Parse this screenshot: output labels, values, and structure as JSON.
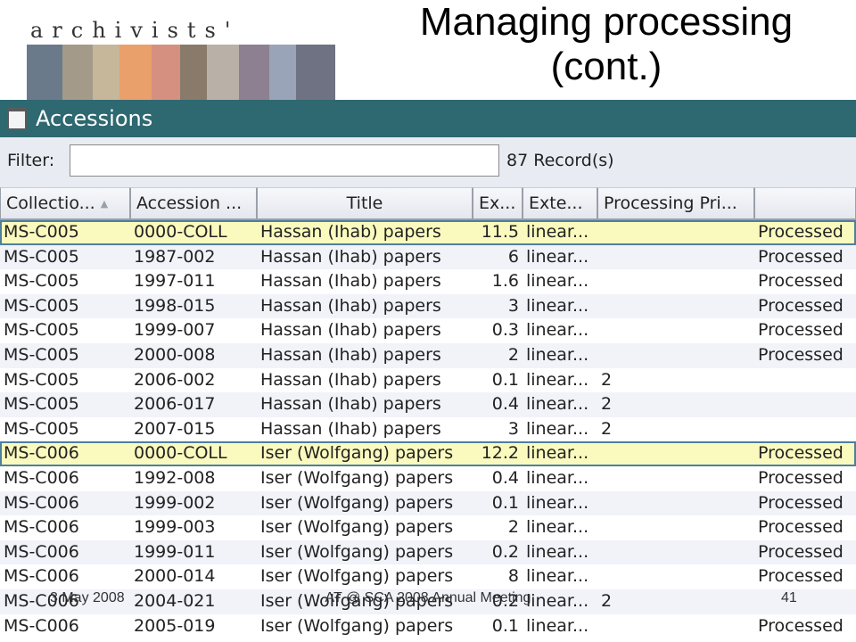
{
  "slide": {
    "logo_text": "archivists'",
    "title": "Managing processing (cont.)",
    "footer_date": "3 May 2008",
    "footer_event": "AT @ SCA 2008 Annual Meeting",
    "footer_page": "41"
  },
  "window": {
    "title": "Accessions",
    "titlebar_color": "#2e6870"
  },
  "filter": {
    "label": "Filter:",
    "value": "",
    "record_count": "87 Record(s)"
  },
  "table": {
    "columns": [
      {
        "label": "Collectio...",
        "sorted": "ascending"
      },
      {
        "label": "Accession ..."
      },
      {
        "label": "Title"
      },
      {
        "label": "Ex..."
      },
      {
        "label": "Exte..."
      },
      {
        "label": "Processing Pri..."
      },
      {
        "label": ""
      }
    ],
    "rows": [
      {
        "c": [
          "MS-C005",
          "0000-COLL",
          "Hassan (Ihab) papers",
          "11.5",
          "linear...",
          "",
          "Processed"
        ],
        "highlight": true
      },
      {
        "c": [
          "MS-C005",
          "1987-002",
          "Hassan (Ihab) papers",
          "6",
          "linear...",
          "",
          "Processed"
        ]
      },
      {
        "c": [
          "MS-C005",
          "1997-011",
          "Hassan (Ihab) papers",
          "1.6",
          "linear...",
          "",
          "Processed"
        ]
      },
      {
        "c": [
          "MS-C005",
          "1998-015",
          "Hassan (Ihab) papers",
          "3",
          "linear...",
          "",
          "Processed"
        ]
      },
      {
        "c": [
          "MS-C005",
          "1999-007",
          "Hassan (Ihab) papers",
          "0.3",
          "linear...",
          "",
          "Processed"
        ]
      },
      {
        "c": [
          "MS-C005",
          "2000-008",
          "Hassan (Ihab) papers",
          "2",
          "linear...",
          "",
          "Processed"
        ]
      },
      {
        "c": [
          "MS-C005",
          "2006-002",
          "Hassan (Ihab) papers",
          "0.1",
          "linear...",
          "2",
          ""
        ]
      },
      {
        "c": [
          "MS-C005",
          "2006-017",
          "Hassan (Ihab) papers",
          "0.4",
          "linear...",
          "2",
          ""
        ]
      },
      {
        "c": [
          "MS-C005",
          "2007-015",
          "Hassan (Ihab) papers",
          "3",
          "linear...",
          "2",
          ""
        ]
      },
      {
        "c": [
          "MS-C006",
          "0000-COLL",
          "Iser (Wolfgang) papers",
          "12.2",
          "linear...",
          "",
          "Processed"
        ],
        "highlight": true
      },
      {
        "c": [
          "MS-C006",
          "1992-008",
          "Iser (Wolfgang) papers",
          "0.4",
          "linear...",
          "",
          "Processed"
        ]
      },
      {
        "c": [
          "MS-C006",
          "1999-002",
          "Iser (Wolfgang) papers",
          "0.1",
          "linear...",
          "",
          "Processed"
        ]
      },
      {
        "c": [
          "MS-C006",
          "1999-003",
          "Iser (Wolfgang) papers",
          "2",
          "linear...",
          "",
          "Processed"
        ]
      },
      {
        "c": [
          "MS-C006",
          "1999-011",
          "Iser (Wolfgang) papers",
          "0.2",
          "linear...",
          "",
          "Processed"
        ]
      },
      {
        "c": [
          "MS-C006",
          "2000-014",
          "Iser (Wolfgang) papers",
          "8",
          "linear...",
          "",
          "Processed"
        ]
      },
      {
        "c": [
          "MS-C006",
          "2004-021",
          "Iser (Wolfgang) papers",
          "0.2",
          "linear...",
          "2",
          ""
        ]
      },
      {
        "c": [
          "MS-C006",
          "2005-019",
          "Iser (Wolfgang) papers",
          "0.1",
          "linear...",
          "",
          "Processed"
        ]
      }
    ]
  }
}
